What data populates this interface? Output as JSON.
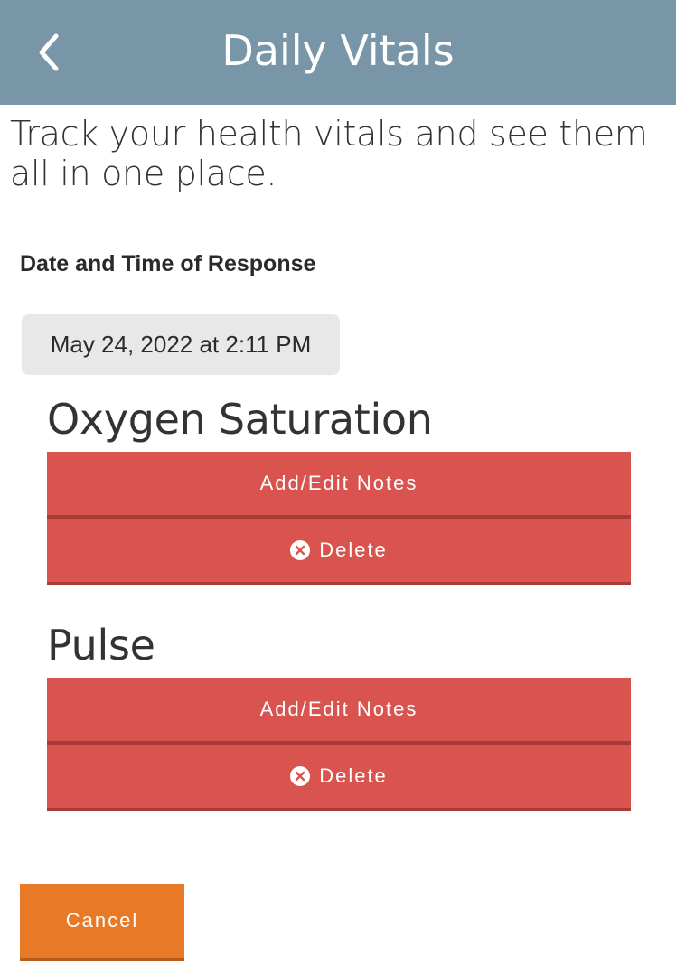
{
  "colors": {
    "header_bg": "#7896a8",
    "danger": "#d9534f",
    "accent": "#e87a27"
  },
  "header": {
    "title": "Daily Vitals",
    "back_icon": "chevron-left-icon"
  },
  "intro_text": "Track your health vitals and see them all in one place.",
  "response": {
    "label": "Date and Time of Response",
    "value": "May 24, 2022 at 2:11 PM"
  },
  "vitals": [
    {
      "title": "Oxygen Saturation",
      "notes_label": "Add/Edit Notes",
      "delete_label": "Delete",
      "delete_icon": "close-circle-icon"
    },
    {
      "title": "Pulse",
      "notes_label": "Add/Edit Notes",
      "delete_label": "Delete",
      "delete_icon": "close-circle-icon"
    }
  ],
  "footer": {
    "cancel_label": "Cancel"
  }
}
